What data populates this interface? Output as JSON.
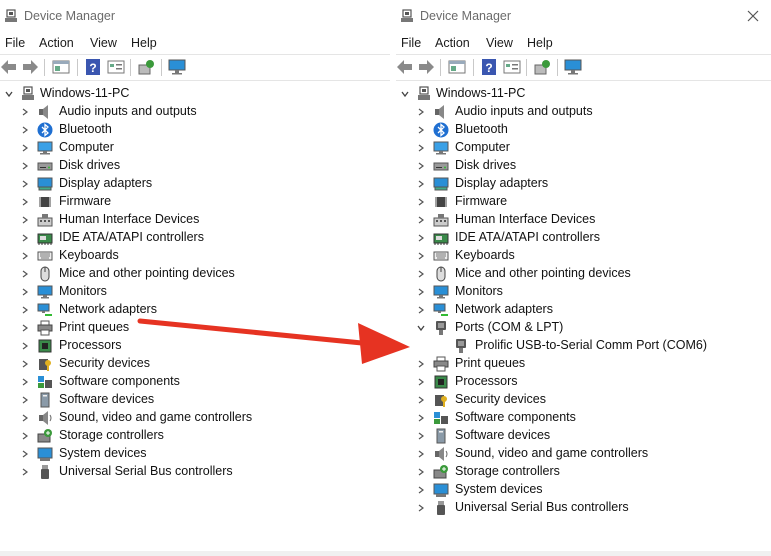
{
  "colors": {
    "arrow": "#e63322",
    "accent": "#0067c0"
  },
  "left_window": {
    "title": "Device Manager",
    "menu": [
      "File",
      "Action",
      "View",
      "Help"
    ],
    "root": "Windows-11-PC",
    "items": [
      {
        "label": "Audio inputs and outputs",
        "icon": "speaker-icon"
      },
      {
        "label": "Bluetooth",
        "icon": "bluetooth-icon"
      },
      {
        "label": "Computer",
        "icon": "computer-icon"
      },
      {
        "label": "Disk drives",
        "icon": "disk-drive-icon"
      },
      {
        "label": "Display adapters",
        "icon": "display-adapter-icon"
      },
      {
        "label": "Firmware",
        "icon": "chip-icon"
      },
      {
        "label": "Human Interface Devices",
        "icon": "hid-icon"
      },
      {
        "label": "IDE ATA/ATAPI controllers",
        "icon": "controller-icon"
      },
      {
        "label": "Keyboards",
        "icon": "keyboard-icon"
      },
      {
        "label": "Mice and other pointing devices",
        "icon": "mouse-icon"
      },
      {
        "label": "Monitors",
        "icon": "monitor-icon"
      },
      {
        "label": "Network adapters",
        "icon": "network-icon"
      },
      {
        "label": "Print queues",
        "icon": "printer-icon"
      },
      {
        "label": "Processors",
        "icon": "processor-icon"
      },
      {
        "label": "Security devices",
        "icon": "security-icon"
      },
      {
        "label": "Software components",
        "icon": "software-component-icon"
      },
      {
        "label": "Software devices",
        "icon": "software-device-icon"
      },
      {
        "label": "Sound, video and game controllers",
        "icon": "sound-icon"
      },
      {
        "label": "Storage controllers",
        "icon": "storage-icon"
      },
      {
        "label": "System devices",
        "icon": "system-icon"
      },
      {
        "label": "Universal Serial Bus controllers",
        "icon": "usb-icon"
      }
    ]
  },
  "right_window": {
    "title": "Device Manager",
    "menu": [
      "File",
      "Action",
      "View",
      "Help"
    ],
    "root": "Windows-11-PC",
    "items": [
      {
        "label": "Audio inputs and outputs",
        "icon": "speaker-icon"
      },
      {
        "label": "Bluetooth",
        "icon": "bluetooth-icon"
      },
      {
        "label": "Computer",
        "icon": "computer-icon"
      },
      {
        "label": "Disk drives",
        "icon": "disk-drive-icon"
      },
      {
        "label": "Display adapters",
        "icon": "display-adapter-icon"
      },
      {
        "label": "Firmware",
        "icon": "chip-icon"
      },
      {
        "label": "Human Interface Devices",
        "icon": "hid-icon"
      },
      {
        "label": "IDE ATA/ATAPI controllers",
        "icon": "controller-icon"
      },
      {
        "label": "Keyboards",
        "icon": "keyboard-icon"
      },
      {
        "label": "Mice and other pointing devices",
        "icon": "mouse-icon"
      },
      {
        "label": "Monitors",
        "icon": "monitor-icon"
      },
      {
        "label": "Network adapters",
        "icon": "network-icon"
      },
      {
        "label": "Ports (COM & LPT)",
        "icon": "port-icon",
        "expanded": true
      },
      {
        "label": "Prolific USB-to-Serial Comm Port (COM6)",
        "icon": "port-icon",
        "child": true
      },
      {
        "label": "Print queues",
        "icon": "printer-icon"
      },
      {
        "label": "Processors",
        "icon": "processor-icon"
      },
      {
        "label": "Security devices",
        "icon": "security-icon"
      },
      {
        "label": "Software components",
        "icon": "software-component-icon"
      },
      {
        "label": "Software devices",
        "icon": "software-device-icon"
      },
      {
        "label": "Sound, video and game controllers",
        "icon": "sound-icon"
      },
      {
        "label": "Storage controllers",
        "icon": "storage-icon"
      },
      {
        "label": "System devices",
        "icon": "system-icon"
      },
      {
        "label": "Universal Serial Bus controllers",
        "icon": "usb-icon"
      }
    ]
  }
}
